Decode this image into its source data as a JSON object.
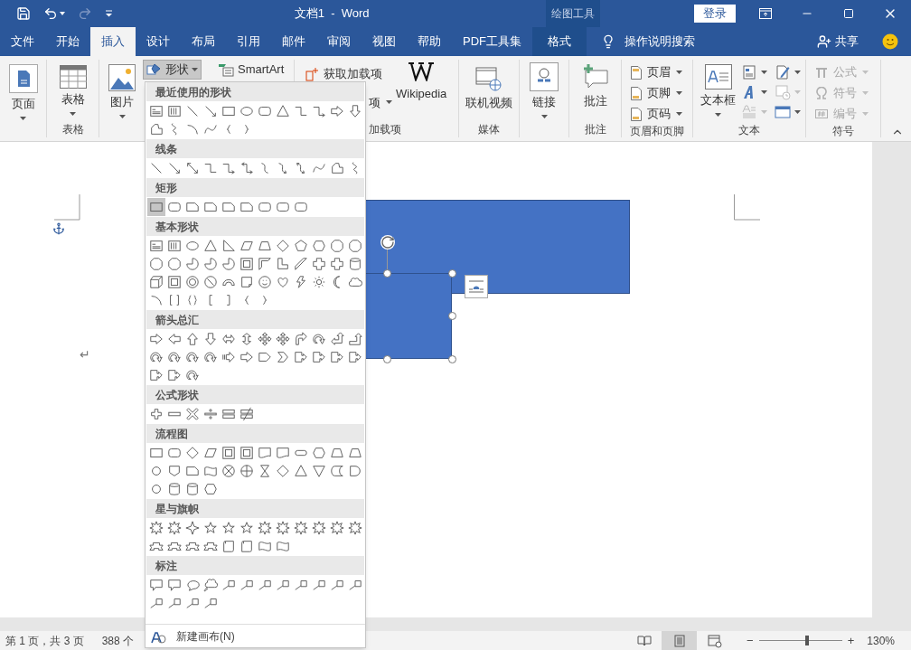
{
  "title_bar": {
    "quick_access": [
      {
        "kind": "save",
        "disabled": false
      },
      {
        "kind": "undo",
        "disabled": false
      },
      {
        "kind": "redo",
        "disabled": true
      },
      {
        "kind": "customize",
        "disabled": false
      }
    ],
    "title": "文档1  -  Word",
    "context_label": "绘图工具",
    "sign_in": "登录"
  },
  "tabs": [
    {
      "label": "文件",
      "selected": false,
      "contextual": false
    },
    {
      "label": "开始",
      "selected": false,
      "contextual": false
    },
    {
      "label": "插入",
      "selected": true,
      "contextual": false
    },
    {
      "label": "设计",
      "selected": false,
      "contextual": false
    },
    {
      "label": "布局",
      "selected": false,
      "contextual": false
    },
    {
      "label": "引用",
      "selected": false,
      "contextual": false
    },
    {
      "label": "邮件",
      "selected": false,
      "contextual": false
    },
    {
      "label": "审阅",
      "selected": false,
      "contextual": false
    },
    {
      "label": "视图",
      "selected": false,
      "contextual": false
    },
    {
      "label": "帮助",
      "selected": false,
      "contextual": false
    },
    {
      "label": "PDF工具集",
      "selected": false,
      "contextual": false
    },
    {
      "label": "格式",
      "selected": false,
      "contextual": true
    }
  ],
  "tell_me": "操作说明搜索",
  "share": "共享",
  "ribbon": {
    "page_button": "页面",
    "table_group": {
      "button": "表格",
      "label": "表格"
    },
    "picture_button": "图片",
    "shapes_button": {
      "label": "形状",
      "expanded": true
    },
    "smartart_button": "SmartArt",
    "addins": {
      "get": "获取加载项",
      "my": "项",
      "wikipedia": "Wikipedia",
      "label": "加载项"
    },
    "media": {
      "button": "联机视频",
      "label": "媒体"
    },
    "link_button": "链接",
    "comments": {
      "button": "批注",
      "label": "批注"
    },
    "header_footer": {
      "items": [
        "页眉",
        "页脚",
        "页码"
      ],
      "label": "页眉和页脚"
    },
    "text": {
      "button": "文本框",
      "label": "文本",
      "tools": [
        {
          "kind": "quick-parts",
          "disabled": false
        },
        {
          "kind": "signature",
          "disabled": false
        },
        {
          "kind": "wordart",
          "disabled": false
        },
        {
          "kind": "date",
          "disabled": true
        },
        {
          "kind": "drop-cap",
          "disabled": true
        },
        {
          "kind": "object",
          "disabled": false
        }
      ]
    },
    "symbols": {
      "items": [
        {
          "label": "公式",
          "disabled": true
        },
        {
          "label": "符号",
          "disabled": true
        },
        {
          "label": "编号",
          "disabled": true
        }
      ],
      "label": "符号"
    }
  },
  "shapes_menu": {
    "sections": [
      {
        "title": "最近使用的形状",
        "shapes": [
          {
            "kind": "textbox"
          },
          {
            "kind": "vtextbox"
          },
          {
            "kind": "line"
          },
          {
            "kind": "arrow-line"
          },
          {
            "kind": "rect"
          },
          {
            "kind": "ellipse"
          },
          {
            "kind": "rounded-rect"
          },
          {
            "kind": "triangle"
          },
          {
            "kind": "elbow"
          },
          {
            "kind": "elbow-arrow"
          },
          {
            "kind": "right-arrow"
          },
          {
            "kind": "down-arrow"
          },
          {
            "kind": "freeform"
          },
          {
            "kind": "scribble"
          },
          {
            "kind": "arc"
          },
          {
            "kind": "curve"
          },
          {
            "kind": "left-brace"
          },
          {
            "kind": "right-brace"
          }
        ]
      },
      {
        "title": "线条",
        "shapes": [
          {
            "kind": "line"
          },
          {
            "kind": "arrow-line"
          },
          {
            "kind": "double-arrow-line"
          },
          {
            "kind": "elbow"
          },
          {
            "kind": "elbow-arrow"
          },
          {
            "kind": "elbow-double-arrow"
          },
          {
            "kind": "curve-connector"
          },
          {
            "kind": "curve-arrow"
          },
          {
            "kind": "curve-double-arrow"
          },
          {
            "kind": "curve"
          },
          {
            "kind": "freeform"
          },
          {
            "kind": "scribble"
          }
        ]
      },
      {
        "title": "矩形",
        "shapes": [
          {
            "kind": "rect",
            "selected": true
          },
          {
            "kind": "rounded-rect",
            "selected": false
          },
          {
            "kind": "snip-rect",
            "selected": false
          },
          {
            "kind": "snip-rect",
            "selected": false
          },
          {
            "kind": "snip-rect",
            "selected": false
          },
          {
            "kind": "snip-rect",
            "selected": false
          },
          {
            "kind": "rounded-rect",
            "selected": false
          },
          {
            "kind": "rounded-rect",
            "selected": false
          },
          {
            "kind": "rounded-rect",
            "selected": false
          }
        ]
      },
      {
        "title": "基本形状",
        "shapes": [
          {
            "kind": "textbox"
          },
          {
            "kind": "vtextbox"
          },
          {
            "kind": "ellipse"
          },
          {
            "kind": "triangle"
          },
          {
            "kind": "right-triangle"
          },
          {
            "kind": "parallelogram"
          },
          {
            "kind": "trapezoid"
          },
          {
            "kind": "diamond"
          },
          {
            "kind": "pentagon"
          },
          {
            "kind": "hexagon"
          },
          {
            "kind": "octagon"
          },
          {
            "kind": "octagon"
          },
          {
            "kind": "octagon"
          },
          {
            "kind": "octagon"
          },
          {
            "kind": "pie"
          },
          {
            "kind": "pie"
          },
          {
            "kind": "pie"
          },
          {
            "kind": "frame"
          },
          {
            "kind": "half-frame"
          },
          {
            "kind": "l-shape"
          },
          {
            "kind": "diagonal-stripe"
          },
          {
            "kind": "cross"
          },
          {
            "kind": "cross"
          },
          {
            "kind": "cylinder"
          },
          {
            "kind": "cube"
          },
          {
            "kind": "frame"
          },
          {
            "kind": "donut"
          },
          {
            "kind": "no-symbol"
          },
          {
            "kind": "block-arc"
          },
          {
            "kind": "folded-corner"
          },
          {
            "kind": "smiley"
          },
          {
            "kind": "heart"
          },
          {
            "kind": "lightning"
          },
          {
            "kind": "sun"
          },
          {
            "kind": "moon"
          },
          {
            "kind": "cloud"
          },
          {
            "kind": "arc"
          },
          {
            "kind": "bracket-pair"
          },
          {
            "kind": "brace-pair"
          },
          {
            "kind": "left-bracket"
          },
          {
            "kind": "right-bracket"
          },
          {
            "kind": "left-brace"
          },
          {
            "kind": "right-brace"
          }
        ]
      },
      {
        "title": "箭头总汇",
        "shapes": [
          {
            "kind": "right-arrow"
          },
          {
            "kind": "left-arrow"
          },
          {
            "kind": "up-arrow"
          },
          {
            "kind": "down-arrow"
          },
          {
            "kind": "double-arrow"
          },
          {
            "kind": "up-down-arrow"
          },
          {
            "kind": "quad-arrow"
          },
          {
            "kind": "quad-arrow"
          },
          {
            "kind": "bent-arrow"
          },
          {
            "kind": "curved-arrow"
          },
          {
            "kind": "left-up-arrow"
          },
          {
            "kind": "bent-up-arrow"
          },
          {
            "kind": "curved-arrow"
          },
          {
            "kind": "curved-arrow"
          },
          {
            "kind": "curved-arrow"
          },
          {
            "kind": "curved-arrow"
          },
          {
            "kind": "striped-arrow"
          },
          {
            "kind": "right-arrow"
          },
          {
            "kind": "pentagon-arrow"
          },
          {
            "kind": "chevron"
          },
          {
            "kind": "arrow-callout"
          },
          {
            "kind": "arrow-callout"
          },
          {
            "kind": "arrow-callout"
          },
          {
            "kind": "arrow-callout"
          },
          {
            "kind": "arrow-callout"
          },
          {
            "kind": "arrow-callout"
          },
          {
            "kind": "curved-arrow"
          }
        ]
      },
      {
        "title": "公式形状",
        "shapes": [
          {
            "kind": "plus"
          },
          {
            "kind": "minus"
          },
          {
            "kind": "multiply"
          },
          {
            "kind": "divide"
          },
          {
            "kind": "equal"
          },
          {
            "kind": "not-equal"
          }
        ]
      },
      {
        "title": "流程图",
        "shapes": [
          {
            "kind": "rect"
          },
          {
            "kind": "rounded-rect"
          },
          {
            "kind": "diamond"
          },
          {
            "kind": "parallelogram"
          },
          {
            "kind": "frame"
          },
          {
            "kind": "frame"
          },
          {
            "kind": "document"
          },
          {
            "kind": "document"
          },
          {
            "kind": "terminator"
          },
          {
            "kind": "hexagon"
          },
          {
            "kind": "trapezoid"
          },
          {
            "kind": "trapezoid"
          },
          {
            "kind": "circle"
          },
          {
            "kind": "pentagon-down"
          },
          {
            "kind": "snip-rect"
          },
          {
            "kind": "wave"
          },
          {
            "kind": "cross-circle"
          },
          {
            "kind": "plus-circle"
          },
          {
            "kind": "hourglass"
          },
          {
            "kind": "diamond"
          },
          {
            "kind": "triangle"
          },
          {
            "kind": "down-triangle"
          },
          {
            "kind": "stored-data"
          },
          {
            "kind": "delay"
          },
          {
            "kind": "circle"
          },
          {
            "kind": "cylinder"
          },
          {
            "kind": "cylinder"
          },
          {
            "kind": "hexagon"
          }
        ]
      },
      {
        "title": "星与旗帜",
        "shapes": [
          {
            "kind": "burst"
          },
          {
            "kind": "burst"
          },
          {
            "kind": "star4"
          },
          {
            "kind": "star"
          },
          {
            "kind": "star"
          },
          {
            "kind": "star"
          },
          {
            "kind": "burst"
          },
          {
            "kind": "burst"
          },
          {
            "kind": "burst"
          },
          {
            "kind": "burst"
          },
          {
            "kind": "burst"
          },
          {
            "kind": "burst"
          },
          {
            "kind": "ribbon"
          },
          {
            "kind": "ribbon"
          },
          {
            "kind": "ribbon"
          },
          {
            "kind": "ribbon"
          },
          {
            "kind": "scroll"
          },
          {
            "kind": "scroll"
          },
          {
            "kind": "wave"
          },
          {
            "kind": "wave"
          }
        ]
      },
      {
        "title": "标注",
        "shapes": [
          {
            "kind": "callout"
          },
          {
            "kind": "callout"
          },
          {
            "kind": "oval-callout"
          },
          {
            "kind": "cloud-callout"
          },
          {
            "kind": "line-callout"
          },
          {
            "kind": "line-callout"
          },
          {
            "kind": "line-callout"
          },
          {
            "kind": "line-callout"
          },
          {
            "kind": "line-callout"
          },
          {
            "kind": "line-callout"
          },
          {
            "kind": "line-callout"
          },
          {
            "kind": "line-callout"
          },
          {
            "kind": "line-callout"
          },
          {
            "kind": "line-callout"
          },
          {
            "kind": "line-callout"
          },
          {
            "kind": "line-callout"
          }
        ]
      }
    ],
    "new_canvas": "新建画布(N)"
  },
  "canvas": {
    "shapes": [
      {
        "kind": "rectangle",
        "selected": false
      },
      {
        "kind": "rectangle",
        "selected": true
      }
    ],
    "paragraph_mark": "↵"
  },
  "status_bar": {
    "page_info": "第 1 页，共 3 页",
    "word_count": "388 个",
    "views": [
      {
        "kind": "read",
        "selected": false
      },
      {
        "kind": "print",
        "selected": true
      },
      {
        "kind": "web",
        "selected": false
      }
    ],
    "zoom": {
      "minus": "−",
      "plus": "+",
      "level": 0.58,
      "reading": "130%"
    }
  }
}
